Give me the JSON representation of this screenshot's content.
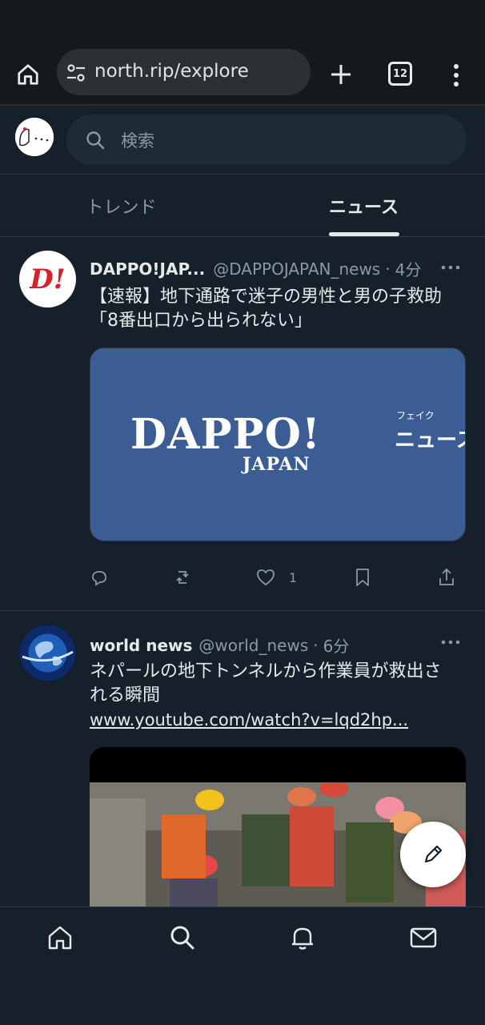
{
  "browser": {
    "url": "north.rip/explore",
    "tab_count": "12"
  },
  "header": {
    "search_placeholder": "検索"
  },
  "tabs": [
    {
      "label": "トレンド",
      "active": false
    },
    {
      "label": "ニュース",
      "active": true
    }
  ],
  "posts": [
    {
      "name": "DAPPO!JAP...",
      "handle": "@DAPPOJAPAN_news",
      "dot": "·",
      "time": "4分",
      "text": "【速報】地下通路で迷子の男性と男の子救助　「8番出口から出られない」",
      "media": {
        "logo_main": "DAPPO!",
        "logo_japan": "JAPAN",
        "logo_fake": "フェイク",
        "logo_news": "ニュース",
        "avatar_text": "D!"
      },
      "actions": {
        "reply": "",
        "repost": "",
        "like_count": "1"
      }
    },
    {
      "name": "world news",
      "handle": "@world_news",
      "dot": "·",
      "time": "6分",
      "text": "ネパールの地下トンネルから作業員が救出される瞬間",
      "link": "www.youtube.com/watch?v=lqd2hp..."
    }
  ],
  "colors": {
    "background": "#15202b",
    "dappo_blue": "#3c5c94",
    "accent_red": "#d6202a"
  }
}
